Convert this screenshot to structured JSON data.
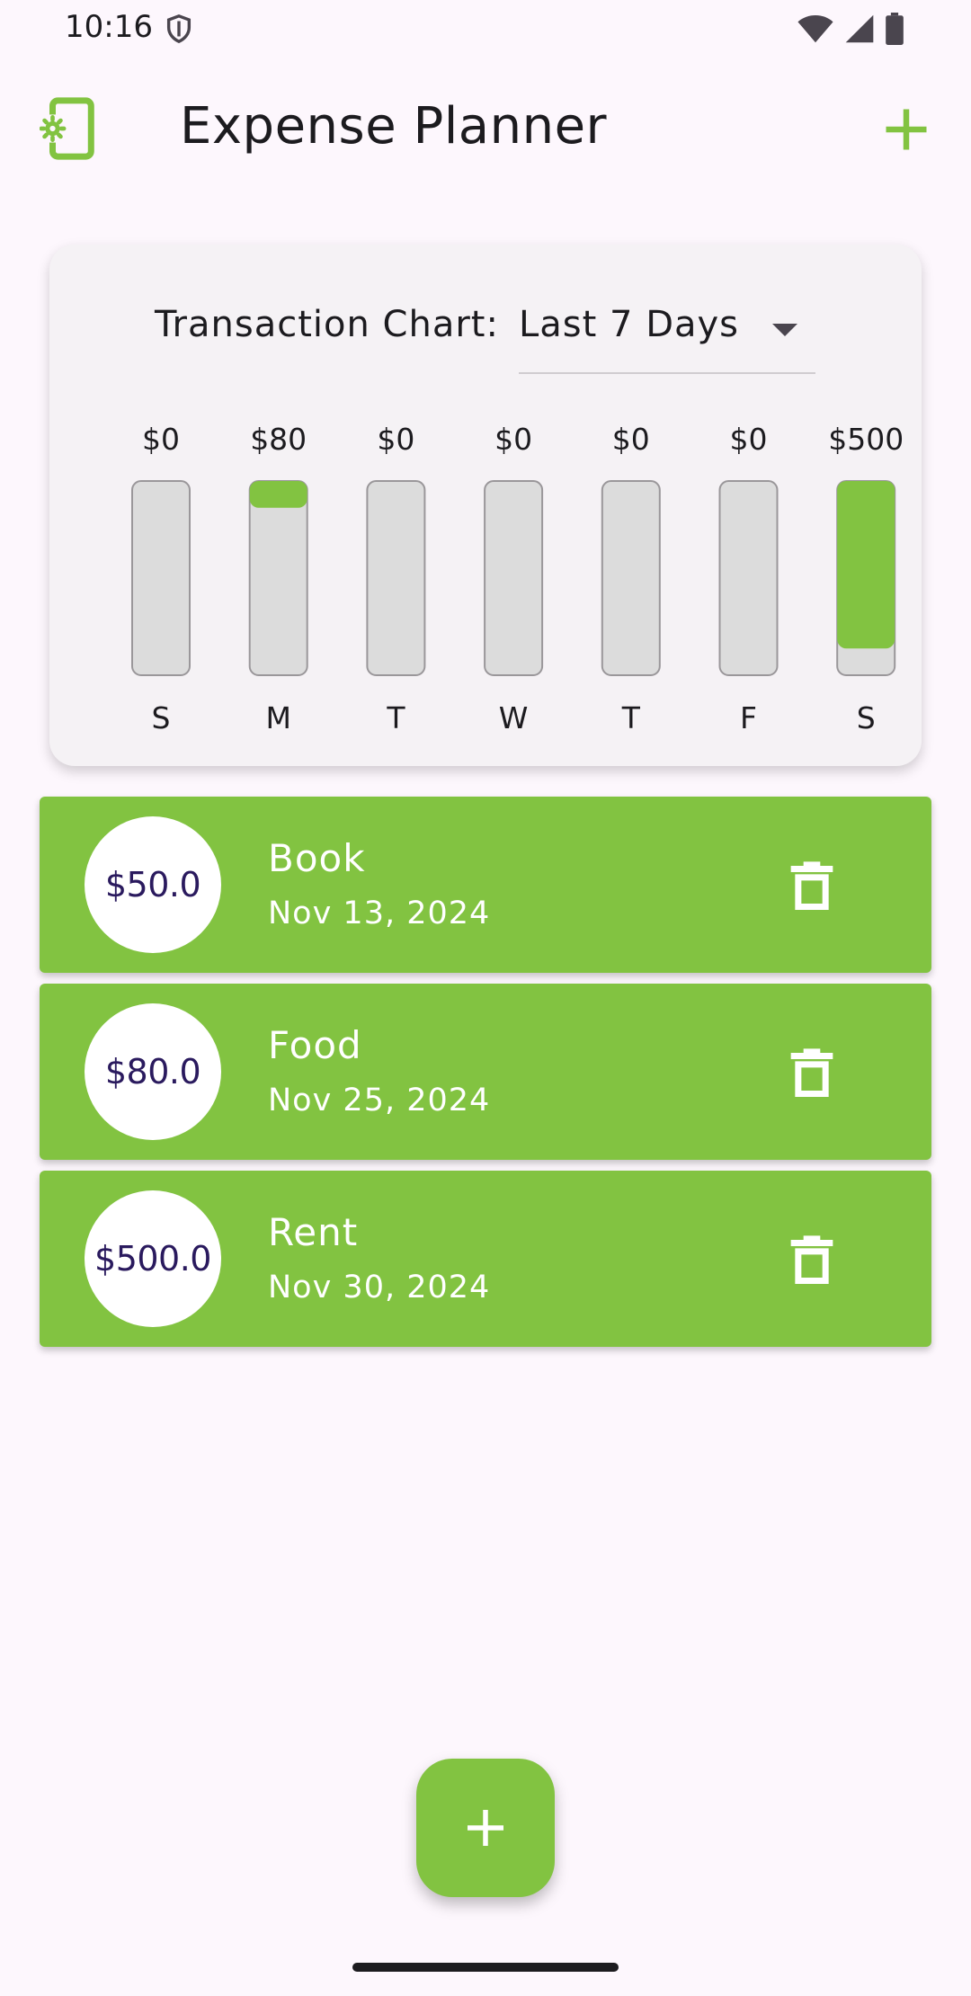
{
  "status_bar": {
    "time": "10:16",
    "icons": [
      "shield-icon",
      "wifi-icon",
      "signal-icon",
      "battery-icon"
    ]
  },
  "app_bar": {
    "title": "Expense Planner",
    "left_icon": "settings-phone-icon",
    "right_icon": "add-icon"
  },
  "chart_card": {
    "label": "Transaction Chart:",
    "range": "Last 7 Days",
    "range_icon": "dropdown-caret-icon"
  },
  "chart_data": {
    "type": "bar",
    "categories": [
      "S",
      "M",
      "T",
      "W",
      "T",
      "F",
      "S"
    ],
    "values": [
      0,
      80,
      0,
      0,
      0,
      0,
      500
    ],
    "value_labels": [
      "$0",
      "$80",
      "$0",
      "$0",
      "$0",
      "$0",
      "$500"
    ],
    "ylim": [
      0,
      580
    ],
    "title": "",
    "xlabel": "",
    "ylabel": ""
  },
  "transactions": [
    {
      "amount": "$50.0",
      "title": "Book",
      "date": "Nov 13, 2024"
    },
    {
      "amount": "$80.0",
      "title": "Food",
      "date": "Nov 25, 2024"
    },
    {
      "amount": "$500.0",
      "title": "Rent",
      "date": "Nov 30, 2024"
    }
  ],
  "colors": {
    "accent": "#82c341",
    "background": "#fdf7fd",
    "card": "#f5f2f5",
    "bar_track": "#dcdcdc",
    "amount_text": "#2a1a5e"
  },
  "fab": {
    "icon": "add-icon"
  }
}
